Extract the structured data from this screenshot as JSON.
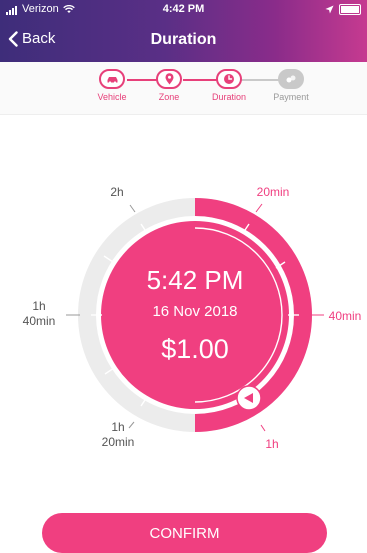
{
  "status_bar": {
    "carrier": "Verizon",
    "time": "4:42 PM"
  },
  "nav": {
    "back_label": "Back",
    "title": "Duration"
  },
  "steps": [
    {
      "label": "Vehicle",
      "state": "done",
      "icon": "car-icon"
    },
    {
      "label": "Zone",
      "state": "done",
      "icon": "location-pin-icon"
    },
    {
      "label": "Duration",
      "state": "done",
      "icon": "clock-icon"
    },
    {
      "label": "Payment",
      "state": "pending",
      "icon": "payment-icon"
    }
  ],
  "dial": {
    "end_time": "5:42 PM",
    "end_date": "16 Nov 2018",
    "price": "$1.00",
    "selected_duration_fraction": 0.5,
    "labels": {
      "twenty": "20min",
      "forty": "40min",
      "one_hour": "1h",
      "one_h": "1h",
      "twenty_min": "20min",
      "one_h_b": "1h",
      "forty_min": "40min",
      "two_h": "2h"
    }
  },
  "confirm_label": "CONFIRM",
  "colors": {
    "accent": "#f03f80",
    "header_start": "#3e2d7a",
    "header_end": "#c63a90"
  }
}
